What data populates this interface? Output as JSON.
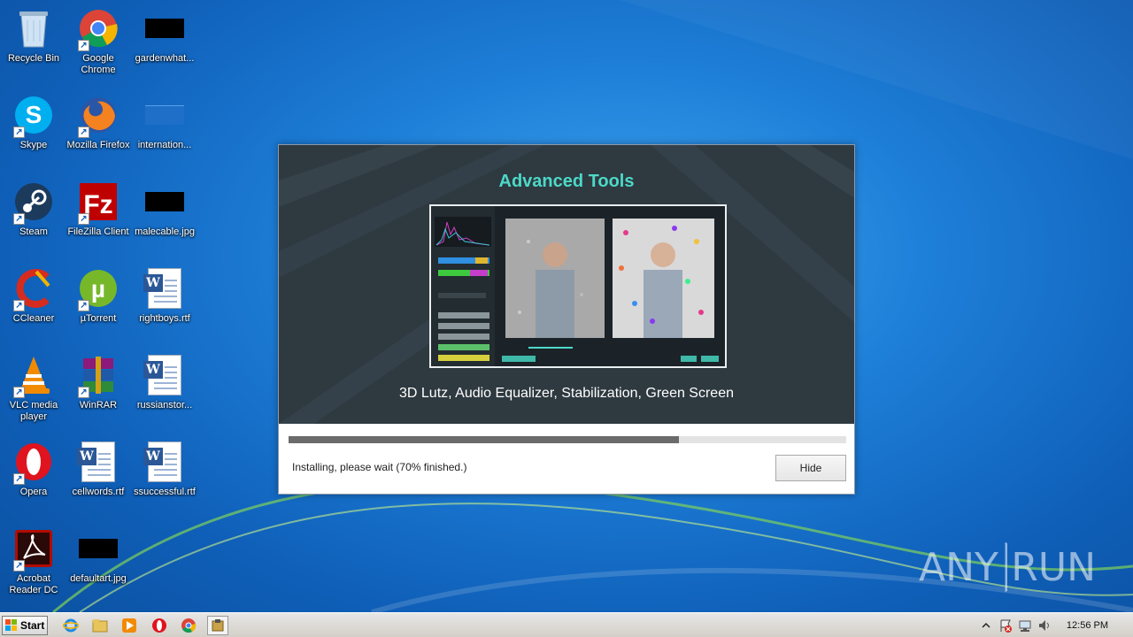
{
  "desktop_icons": [
    {
      "label": "Recycle Bin"
    },
    {
      "label": "Google Chrome"
    },
    {
      "label": "gardenwhat..."
    },
    {
      "label": "Skype"
    },
    {
      "label": "Mozilla Firefox"
    },
    {
      "label": "internation..."
    },
    {
      "label": "Steam"
    },
    {
      "label": "FileZilla Client"
    },
    {
      "label": "malecable.jpg"
    },
    {
      "label": "CCleaner"
    },
    {
      "label": "µTorrent"
    },
    {
      "label": "rightboys.rtf"
    },
    {
      "label": "VLC media player"
    },
    {
      "label": "WinRAR"
    },
    {
      "label": "russianstor..."
    },
    {
      "label": "Opera"
    },
    {
      "label": "cellwords.rtf"
    },
    {
      "label": "ssuccessful.rtf"
    },
    {
      "label": "Acrobat Reader DC"
    },
    {
      "label": "defaultart.jpg"
    }
  ],
  "installer": {
    "banner_title": "Advanced Tools",
    "banner_subtitle": "3D Lutz, Audio Equalizer, Stabilization, Green Screen",
    "progress": 0.7,
    "status_text": "Installing, please wait (70% finished.)",
    "hide_label": "Hide"
  },
  "watermark": {
    "left": "ANY",
    "right": "RUN"
  },
  "taskbar": {
    "start_label": "Start",
    "pinned": [
      "internet-explorer-icon",
      "explorer-folder-icon",
      "media-player-icon",
      "opera-icon",
      "chrome-icon",
      "installer-icon"
    ],
    "clock": "12:56 PM"
  },
  "colors": {
    "accent": "#4dd9c8",
    "banner": "#2e3940",
    "progress": "#6b6b6b"
  }
}
